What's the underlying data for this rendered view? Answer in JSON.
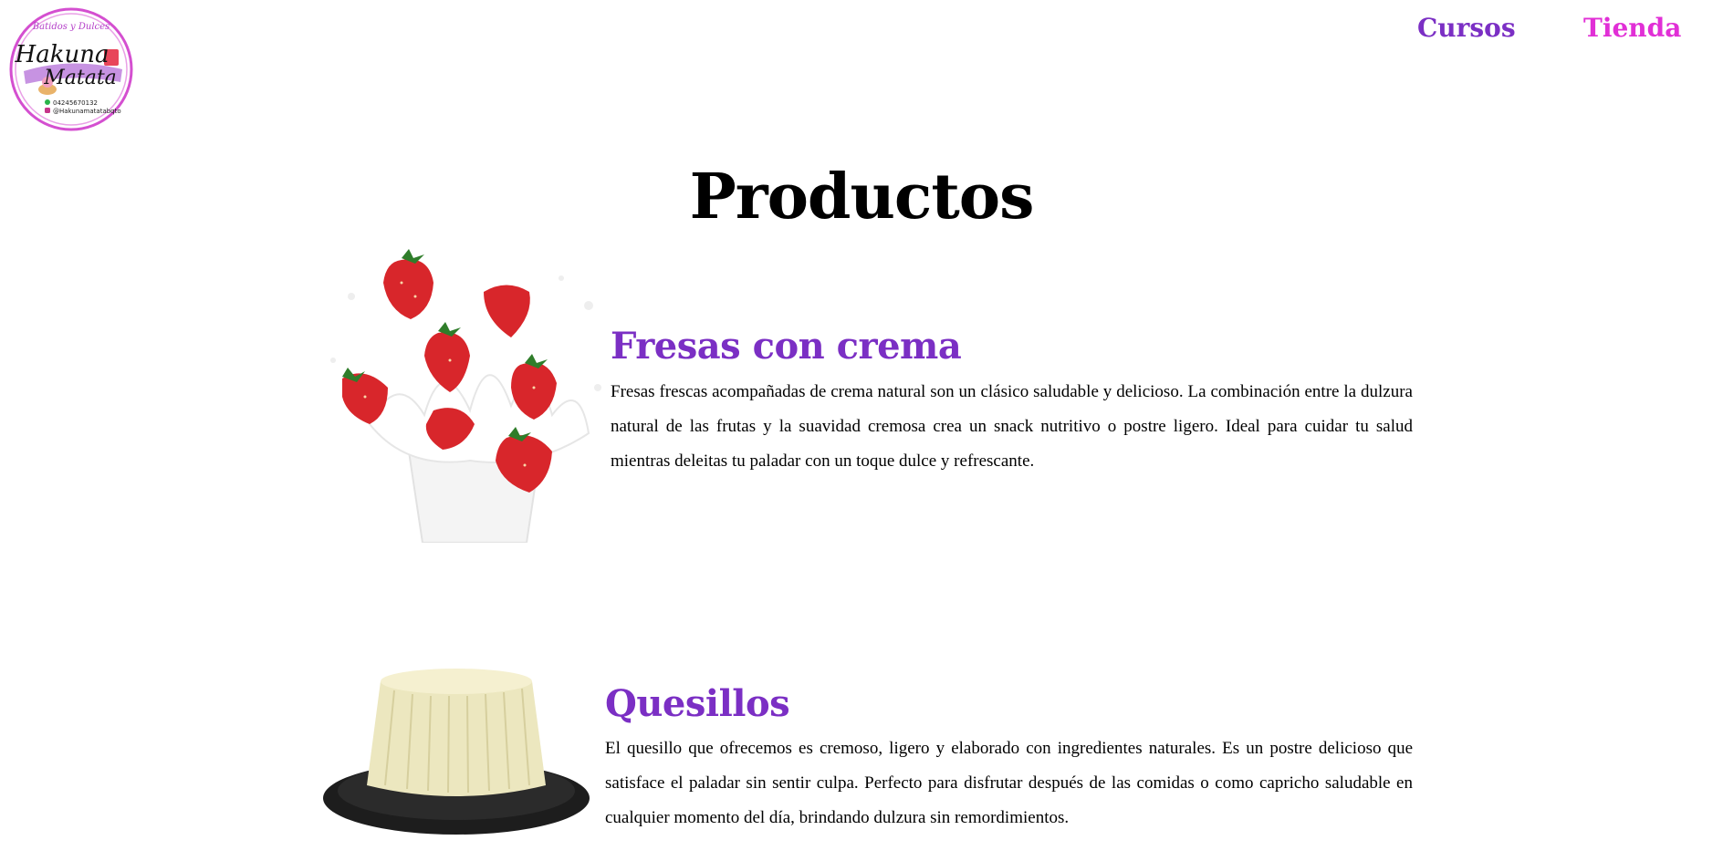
{
  "logo": {
    "top_text": "Batidos y Dulces",
    "name_line1": "Hakuna",
    "name_line2": "Matata",
    "phone": "04245670132",
    "instagram": "@Hakunamatatabqto"
  },
  "nav": {
    "cursos": "Cursos",
    "tienda": "Tienda"
  },
  "page_title": "Productos",
  "products": [
    {
      "name": "Fresas con crema",
      "description": "Fresas frescas acompañadas de crema natural son un clásico saludable y delicioso. La combinación entre la dulzura natural de las frutas y la suavidad cremosa crea un snack nutritivo o postre ligero. Ideal para cuidar tu salud mientras deleitas tu paladar con un toque dulce y refrescante."
    },
    {
      "name": "Quesillos",
      "description": "El quesillo que ofrecemos es cremoso, ligero y elaborado con ingredientes naturales. Es un postre delicioso que satisface el paladar sin sentir culpa. Perfecto para disfrutar después de las comidas o como capricho saludable en cualquier momento del día, brindando dulzura sin remordimientos."
    }
  ],
  "colors": {
    "purple": "#7b2fc4",
    "magenta": "#e12fd6"
  }
}
